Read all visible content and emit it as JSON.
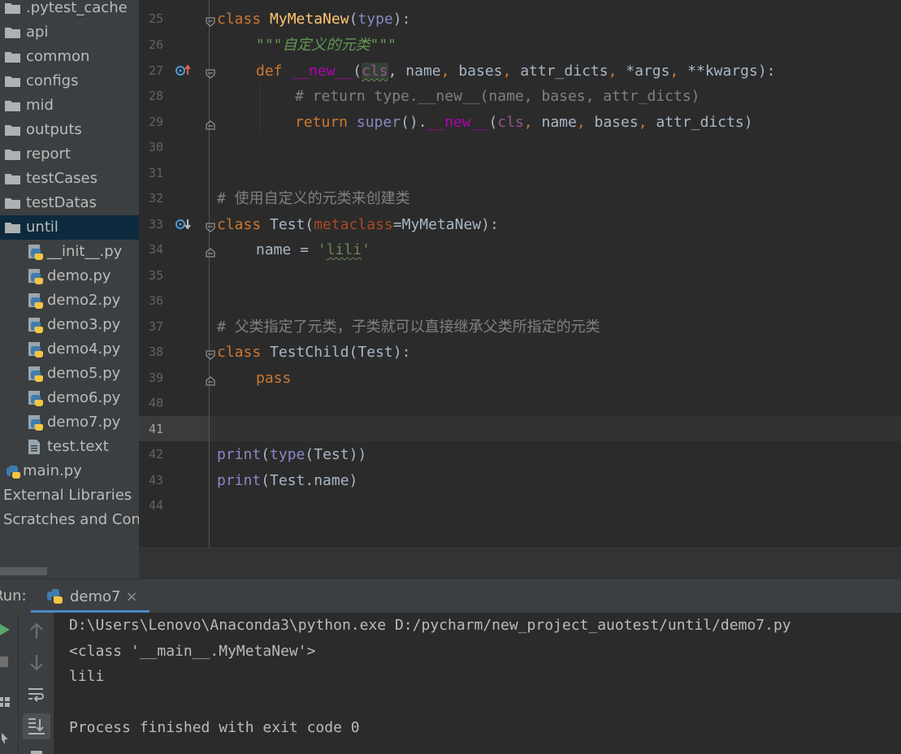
{
  "project_tree": {
    "items": [
      {
        "label": ".pytest_cache",
        "type": "folder"
      },
      {
        "label": "api",
        "type": "folder"
      },
      {
        "label": "common",
        "type": "folder"
      },
      {
        "label": "configs",
        "type": "folder"
      },
      {
        "label": "mid",
        "type": "folder"
      },
      {
        "label": "outputs",
        "type": "folder"
      },
      {
        "label": "report",
        "type": "folder"
      },
      {
        "label": "testCases",
        "type": "folder"
      },
      {
        "label": "testDatas",
        "type": "folder"
      },
      {
        "label": "until",
        "type": "folder",
        "selected": true
      },
      {
        "label": "__init__.py",
        "type": "python"
      },
      {
        "label": "demo.py",
        "type": "python"
      },
      {
        "label": "demo2.py",
        "type": "python"
      },
      {
        "label": "demo3.py",
        "type": "python"
      },
      {
        "label": "demo4.py",
        "type": "python"
      },
      {
        "label": "demo5.py",
        "type": "python"
      },
      {
        "label": "demo6.py",
        "type": "python"
      },
      {
        "label": "demo7.py",
        "type": "python"
      },
      {
        "label": "test.text",
        "type": "text"
      },
      {
        "label": "main.py",
        "type": "python"
      },
      {
        "label": "External Libraries",
        "type": "node"
      },
      {
        "label": "Scratches and Cons",
        "type": "node"
      }
    ]
  },
  "editor": {
    "line_numbers": [
      "25",
      "26",
      "27",
      "28",
      "29",
      "30",
      "31",
      "32",
      "33",
      "34",
      "35",
      "36",
      "37",
      "38",
      "39",
      "40",
      "41",
      "42",
      "43",
      "44"
    ],
    "current_line": "41",
    "code": {
      "l25": {
        "kw": "class",
        "name": "MyMetaNew",
        "open": "(",
        "base": "type",
        "close": "):"
      },
      "l26": {
        "docstring": "\"\"\"自定义的元类\"\"\""
      },
      "l27": {
        "kw": "def",
        "fname": "__new__",
        "open": "(",
        "cls": "cls",
        "rest1": ", name",
        "c1": ",",
        "rest2": " bases",
        "c2": ",",
        "rest3": " attr_dicts",
        "c3": ",",
        "rest4": " *args",
        "c4": ",",
        "rest5": " **kwargs):"
      },
      "l28": {
        "comment": "# return type.__new__(name, bases, attr_dicts)"
      },
      "l29": {
        "kw": "return",
        "super": "super",
        "p1": "().",
        "fname": "__new__",
        "open": "(",
        "cls": "cls",
        "c1": ",",
        "a1": " name",
        "c2": ",",
        "a2": " bases",
        "c3": ",",
        "a3": " attr_dicts)"
      },
      "l32": {
        "comment": "# 使用自定义的元类来创建类"
      },
      "l33": {
        "kw": "class",
        "name": " Test(",
        "metaclass": "metaclass",
        "rest": "=MyMetaNew):"
      },
      "l34": {
        "lhs": "name = ",
        "q1": "'",
        "value": "lili",
        "q2": "'"
      },
      "l37": {
        "comment": "# 父类指定了元类，子类就可以直接继承父类所指定的元类"
      },
      "l38": {
        "kw": "class",
        "rest": " TestChild(Test):"
      },
      "l39": {
        "kw": "pass"
      },
      "l42": {
        "print": "print",
        "p1": "(",
        "type": "type",
        "rest": "(Test))"
      },
      "l43": {
        "print": "print",
        "rest": "(Test.name)"
      }
    }
  },
  "run_panel": {
    "label": "Run:",
    "tab_label": "demo7",
    "tab_close": "×",
    "console_lines": [
      "D:\\Users\\Lenovo\\Anaconda3\\python.exe D:/pycharm/new_project_auotest/until/demo7.py",
      "<class '__main__.MyMetaNew'>",
      "lili",
      "",
      "Process finished with exit code 0"
    ]
  },
  "colors": {
    "tree_bg": "#3c3f41",
    "selection": "#0d293e",
    "editor_bg": "#2b2b2b",
    "keyword": "#cc7832",
    "dunder": "#b200b2",
    "string": "#6a8759",
    "comment": "#808080"
  }
}
